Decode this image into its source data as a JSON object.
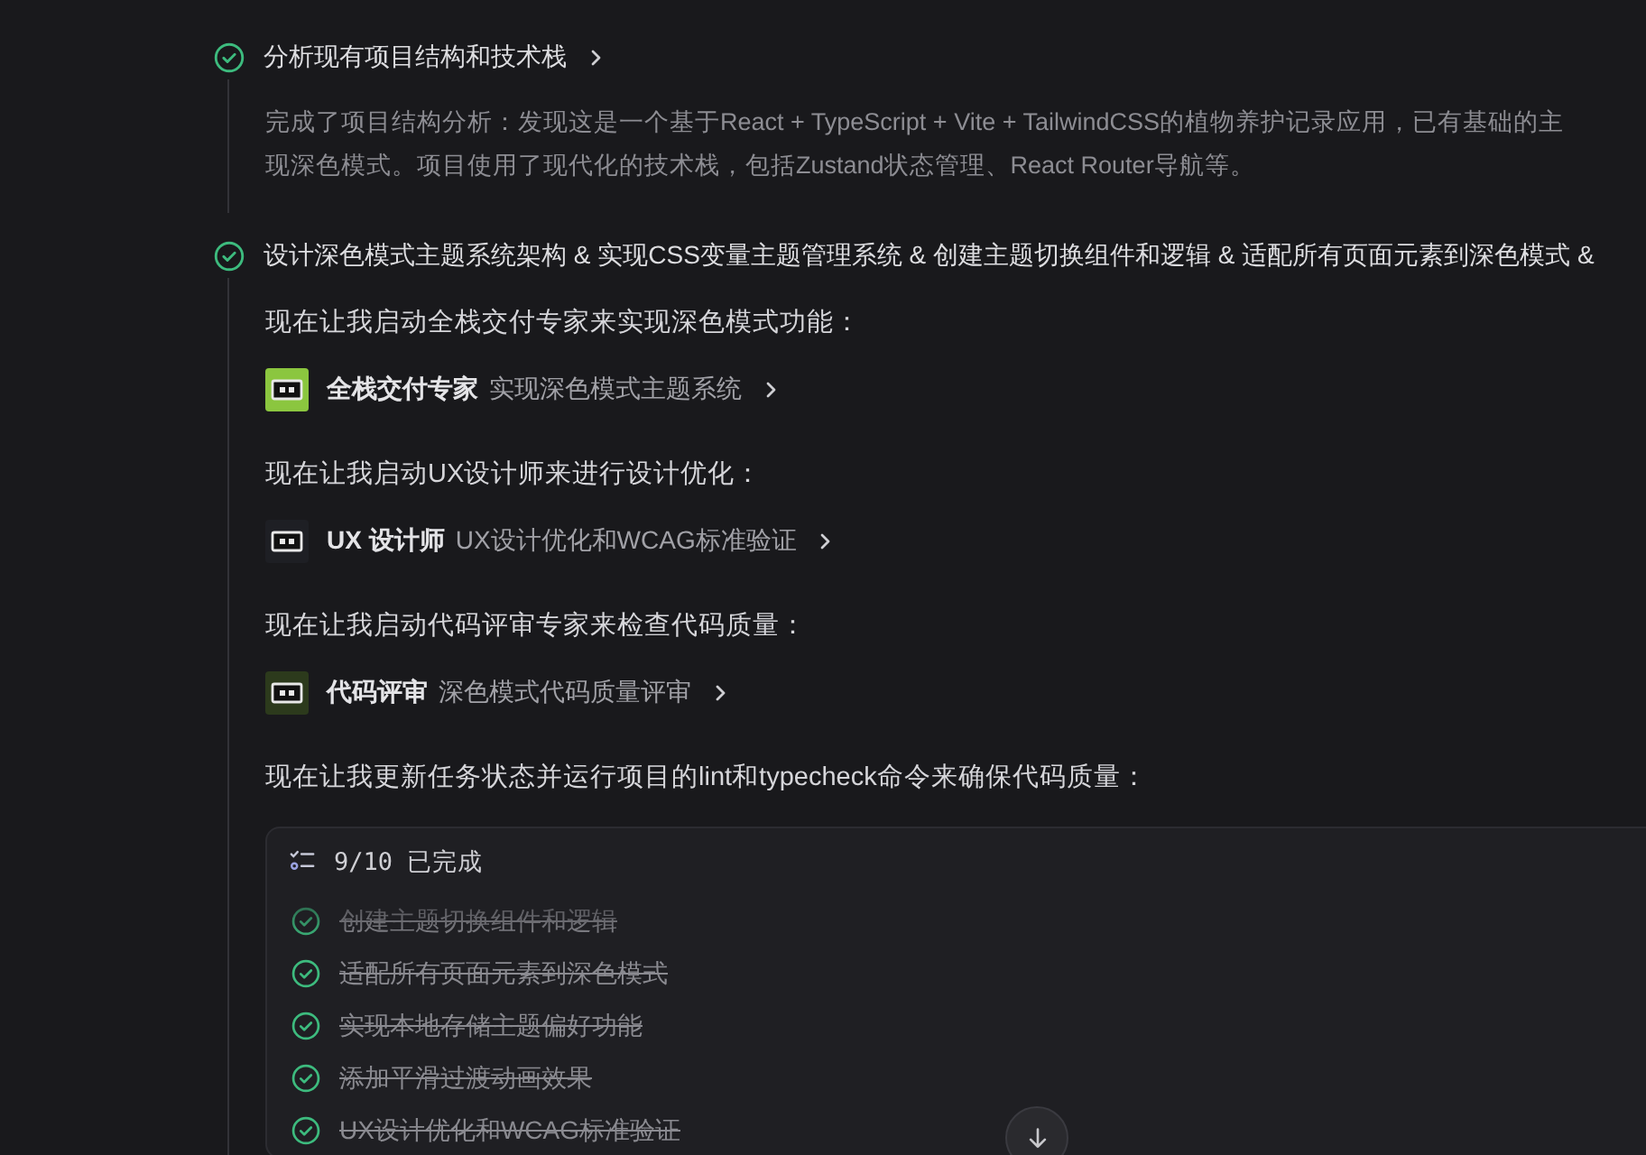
{
  "tasks": [
    {
      "title": "分析现有项目结构和技术栈",
      "done": true,
      "blocks": [
        {
          "kind": "note",
          "text": "完成了项目结构分析：发现这是一个基于React + TypeScript + Vite + TailwindCSS的植物养护记录应用，已有基础的主"
        },
        {
          "kind": "note",
          "text": "现深色模式。项目使用了现代化的技术栈，包括Zustand状态管理、React Router导航等。"
        }
      ]
    },
    {
      "title": "设计深色模式主题系统架构 & 实现CSS变量主题管理系统 & 创建主题切换组件和逻辑 & 适配所有页面元素到深色模式 &",
      "done": true,
      "blocks": [
        {
          "kind": "text",
          "text": "现在让我启动全栈交付专家来实现深色模式功能："
        },
        {
          "kind": "agent",
          "name": "全栈交付专家",
          "task": "实现深色模式主题系统",
          "color": "#8bc63f"
        },
        {
          "kind": "text",
          "text": "现在让我启动UX设计师来进行设计优化："
        },
        {
          "kind": "agent",
          "name": "UX 设计师",
          "task": "UX设计优化和WCAG标准验证",
          "color": "#1e1f24"
        },
        {
          "kind": "text",
          "text": "现在让我启动代码评审专家来检查代码质量："
        },
        {
          "kind": "agent",
          "name": "代码评审",
          "task": "深色模式代码质量评审",
          "color": "#2c3a1c"
        },
        {
          "kind": "text",
          "text": "现在让我更新任务状态并运行项目的lint和typecheck命令来确保代码质量："
        },
        {
          "kind": "todo",
          "summary": "9/10 已完成",
          "items": [
            {
              "text": "创建主题切换组件和逻辑",
              "done": true
            },
            {
              "text": "适配所有页面元素到深色模式",
              "done": true
            },
            {
              "text": "实现本地存储主题偏好功能",
              "done": true
            },
            {
              "text": "添加平滑过渡动画效果",
              "done": true
            },
            {
              "text": "UX设计优化和WCAG标准验证",
              "done": true
            }
          ]
        }
      ]
    }
  ]
}
